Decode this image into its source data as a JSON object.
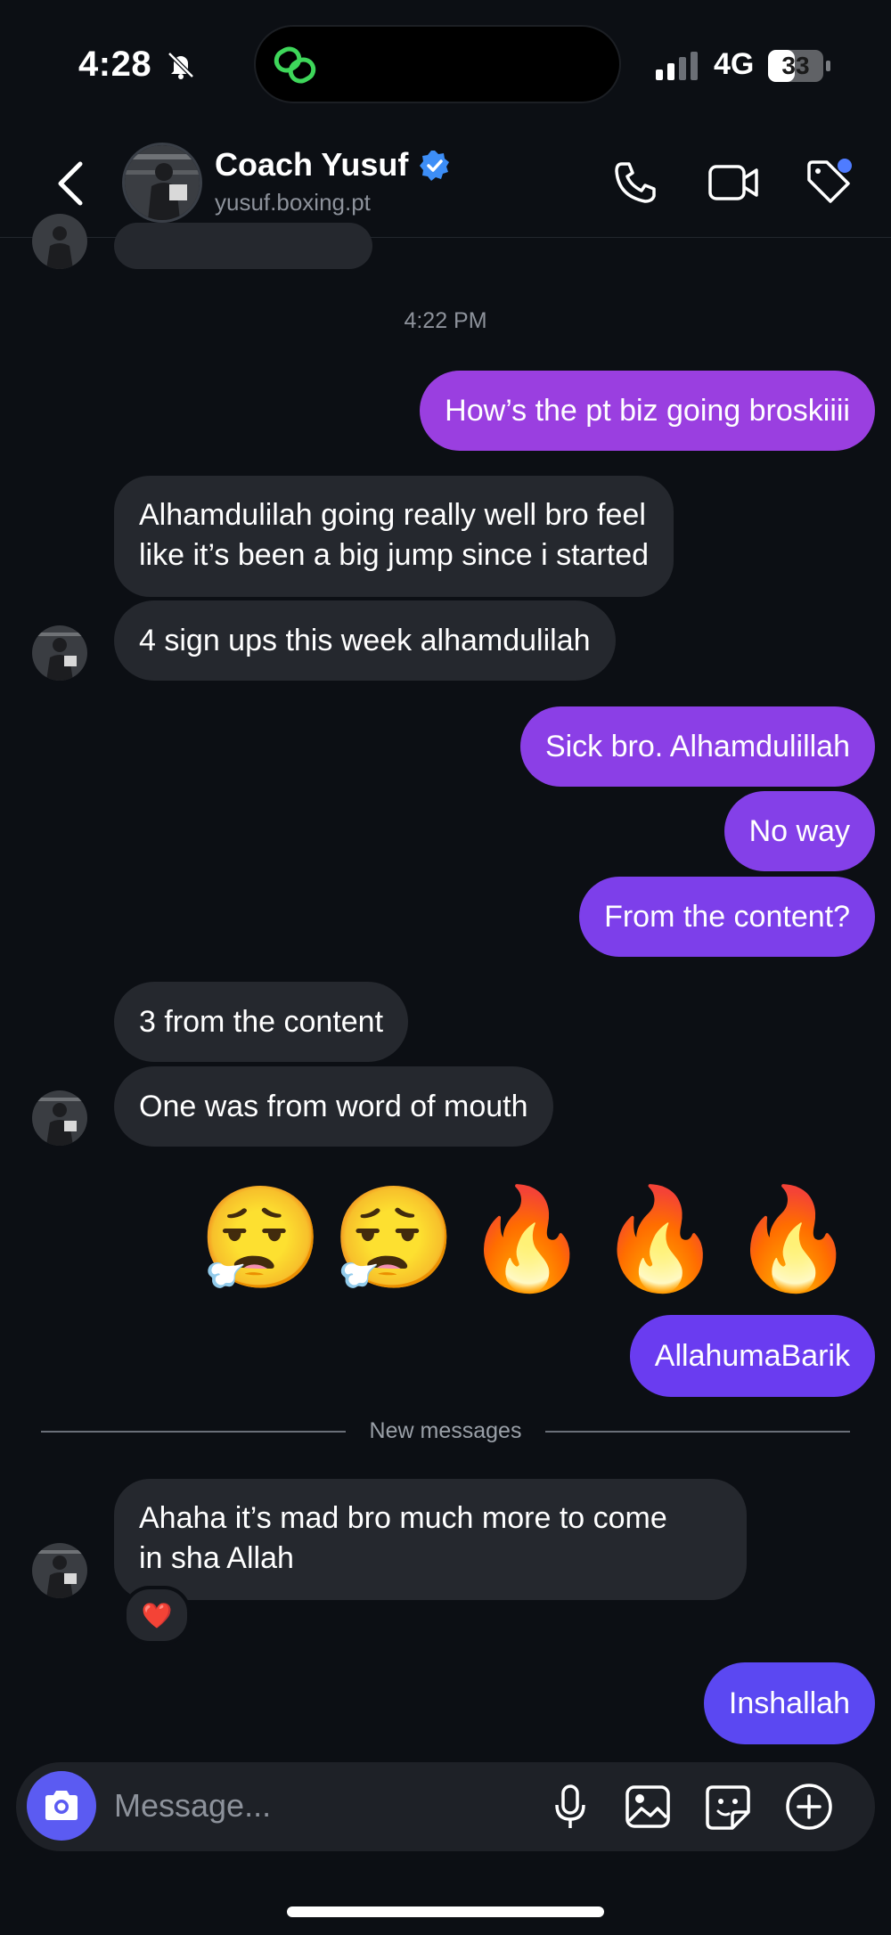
{
  "status_bar": {
    "time": "4:28",
    "network": "4G",
    "battery": "33"
  },
  "header": {
    "name": "Coach Yusuf",
    "handle": "yusuf.boxing.pt"
  },
  "timestamp": "4:22 PM",
  "messages": [
    {
      "side": "out",
      "text": "How’s the pt biz going broskiiii"
    },
    {
      "side": "in",
      "lines": [
        "Alhamdulilah going really well bro feel",
        "like it’s been a big jump since i started"
      ]
    },
    {
      "side": "in",
      "text": "4 sign ups this week alhamdulilah"
    },
    {
      "side": "out",
      "text": "Sick bro. Alhamdulillah"
    },
    {
      "side": "out",
      "text": "No way"
    },
    {
      "side": "out",
      "text": "From the content?"
    },
    {
      "side": "in",
      "text": "3 from the content"
    },
    {
      "side": "in",
      "text": "One was from word of mouth"
    },
    {
      "side": "out",
      "text": "😮‍💨😮‍💨🔥🔥🔥"
    },
    {
      "side": "out",
      "text": "AllahumaBarik"
    },
    {
      "side": "in",
      "lines": [
        "Ahaha it’s mad bro much more to come",
        "in sha Allah"
      ]
    },
    {
      "side": "out",
      "text": "Inshallah"
    }
  ],
  "reaction": "❤️",
  "divider_label": "New messages",
  "composer": {
    "placeholder": "Message..."
  },
  "colors": {
    "background": "#0c0f14",
    "incoming": "#25282e",
    "outgoing_purple": "#9a3fe0",
    "outgoing_violet": "#6a3cf0",
    "accent": "#5b5bf2",
    "verified": "#3d8ef7"
  },
  "icons": [
    "bell-slash-icon",
    "chain-link-icon",
    "back-chevron-icon",
    "verified-badge-icon",
    "phone-icon",
    "video-camera-icon",
    "tag-icon",
    "camera-icon",
    "microphone-icon",
    "gallery-icon",
    "sticker-icon",
    "plus-circle-icon"
  ]
}
